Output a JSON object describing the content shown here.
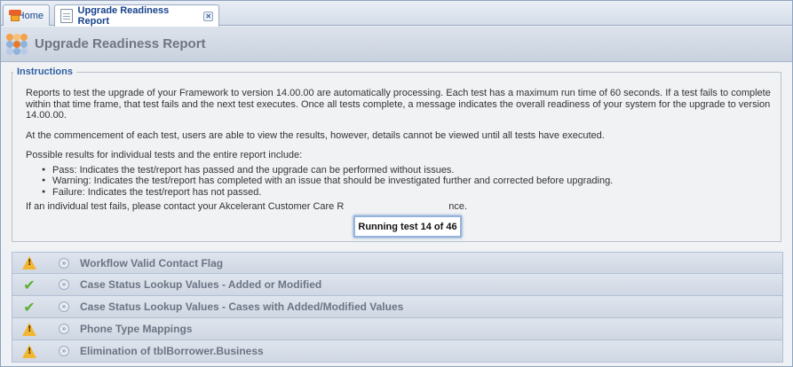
{
  "tabs": [
    {
      "label": "Home",
      "icon": "home-icon"
    },
    {
      "label": "Upgrade Readiness Report",
      "icon": "document-icon",
      "closable": true
    }
  ],
  "header": {
    "title": "Upgrade Readiness Report"
  },
  "instructions": {
    "legend": "Instructions",
    "para1": "Reports to test the upgrade of your Framework to version 14.00.00 are automatically processing. Each test has a maximum run time of 60 seconds. If a test fails to complete within that time frame, that test fails and the next test executes. Once all tests complete, a message indicates the overall readiness of your system for the upgrade to version 14.00.00.",
    "para2": "At the commencement of each test, users are able to view the results, however, details cannot be viewed until all tests have executed.",
    "para3": "Possible results for individual tests and the entire report include:",
    "bullets": [
      "Pass: Indicates the test/report has passed and the upgrade can be performed without issues.",
      "Warning: Indicates the test/report has completed with an issue that should be investigated further and corrected before upgrading.",
      "Failure: Indicates the test/report has not passed."
    ],
    "para4_start": "If an individual test fails, please contact your Akcelerant Customer Care R",
    "para4_end": "nce."
  },
  "popup": {
    "text": "Running test 14 of 46"
  },
  "tests": [
    {
      "status": "warning",
      "title": "Workflow Valid Contact Flag"
    },
    {
      "status": "pass",
      "title": "Case Status Lookup Values - Added or Modified"
    },
    {
      "status": "pass",
      "title": "Case Status Lookup Values - Cases with Added/Modified Values"
    },
    {
      "status": "warning",
      "title": "Phone Type Mappings"
    },
    {
      "status": "warning",
      "title": "Elimination of tblBorrower.Business"
    }
  ],
  "colors": {
    "link_blue": "#15428b",
    "legend_blue": "#2e5fa3",
    "warning": "#f2b632",
    "pass": "#5bb131"
  }
}
